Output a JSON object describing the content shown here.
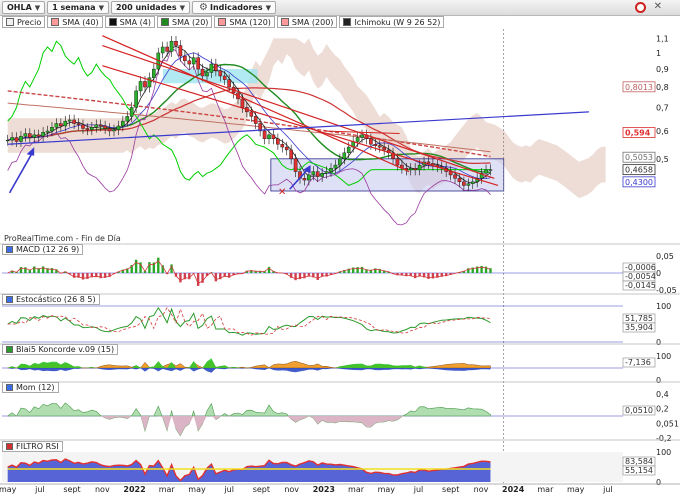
{
  "toolbar": {
    "symbol": "OHLA",
    "timeframe": "1 semana",
    "units": "200 unidades",
    "indicators": "Indicadores"
  },
  "legend": [
    {
      "label": "Precio",
      "color": "#f0f0f0"
    },
    {
      "label": "SMA (40)",
      "color": "#ff9999"
    },
    {
      "label": "SMA (4)",
      "color": "#101010"
    },
    {
      "label": "SMA (20)",
      "color": "#1f8b1f"
    },
    {
      "label": "SMA (120)",
      "color": "#ff9999"
    },
    {
      "label": "SMA (200)",
      "color": "#ff9999"
    },
    {
      "label": "Ichimoku (W 9 26 52)",
      "color": "#222222"
    }
  ],
  "source_label": "ProRealTime.com - Fin de Día",
  "panels": {
    "macd": {
      "title": "MACD (12 26 9)",
      "color": "#3a6ee8"
    },
    "stoch": {
      "title": "Estocástico (26 8 5)",
      "color": "#3a6ee8"
    },
    "koncorde": {
      "title": "Blai5 Koncorde v.09 (15)",
      "color": "#2a9a2a"
    },
    "mom": {
      "title": "Mom (12)",
      "color": "#3a6ee8"
    },
    "rsi": {
      "title": "FILTRO RSI",
      "color": "#d03030"
    }
  },
  "colors": {
    "bull_candle": "#2ab02a",
    "bear_candle": "#e03030",
    "trendline_red": "#d42222",
    "trendline_blue": "#3a3acf",
    "kumo_fill": "#e8d2c8",
    "support_box": "#c8ccee",
    "sma20": "#1f8b1f",
    "sma40": "#cc3333",
    "sma4": "#222222",
    "kijun": "#3a3acf",
    "senkou_b": "#c07060",
    "sma120": "#cc4444",
    "chikou": "#00d000"
  },
  "chart_data": [
    {
      "id": "price",
      "type": "candlestick",
      "x_label_positions": [
        "may",
        "jul",
        "sept",
        "nov",
        "2022",
        "mar",
        "may",
        "jul",
        "sept",
        "nov",
        "2023",
        "mar",
        "may",
        "jul",
        "sept",
        "nov",
        "2024",
        "mar",
        "may",
        "jul"
      ],
      "x_range": [
        2021.3,
        2024.58
      ],
      "y_scale": "log",
      "y_ticks": [
        1.1,
        1,
        0.9,
        0.8,
        0.7,
        0.6,
        0.5
      ],
      "y_range": [
        0.29,
        1.17
      ],
      "series": [
        {
          "name": "Precio",
          "weekly_close": [
            0.565,
            0.575,
            0.56,
            0.58,
            0.59,
            0.575,
            0.585,
            0.58,
            0.595,
            0.6,
            0.615,
            0.63,
            0.62,
            0.64,
            0.645,
            0.63,
            0.625,
            0.61,
            0.605,
            0.615,
            0.625,
            0.62,
            0.61,
            0.6,
            0.605,
            0.62,
            0.64,
            0.66,
            0.7,
            0.78,
            0.83,
            0.8,
            0.85,
            0.9,
            1.0,
            1.04,
            1.01,
            1.08,
            1.05,
            0.98,
            0.95,
            0.93,
            0.97,
            0.9,
            0.86,
            0.88,
            0.93,
            0.89,
            0.86,
            0.84,
            0.8,
            0.77,
            0.74,
            0.7,
            0.68,
            0.66,
            0.63,
            0.6,
            0.57,
            0.585,
            0.57,
            0.55,
            0.54,
            0.53,
            0.5,
            0.46,
            0.44,
            0.435,
            0.45,
            0.46,
            0.445,
            0.455,
            0.46,
            0.47,
            0.48,
            0.5,
            0.52,
            0.54,
            0.56,
            0.575,
            0.585,
            0.57,
            0.55,
            0.545,
            0.54,
            0.53,
            0.52,
            0.5,
            0.48,
            0.47,
            0.465,
            0.47,
            0.465,
            0.48,
            0.49,
            0.485,
            0.48,
            0.475,
            0.47,
            0.46,
            0.45,
            0.44,
            0.43,
            0.42,
            0.425,
            0.43,
            0.44,
            0.455,
            0.465,
            0.4658
          ]
        },
        {
          "name": "SMA (20)",
          "path": "smooth",
          "note": "green long-average line"
        },
        {
          "name": "SMA (40)",
          "path": "smooth",
          "note": "red long-average line"
        },
        {
          "name": "SMA (120)",
          "path": "smooth",
          "note": "dashed red/brown line"
        },
        {
          "name": "Ichimoku (W 9 26 52)",
          "path": "cloud",
          "note": "kumo cloud plus tenkan/kijun lines"
        }
      ],
      "annotations": [
        {
          "text": "0,8013",
          "color": "#c06060"
        },
        {
          "text": "0,594",
          "color": "#e03030",
          "emphasis": true
        },
        {
          "text": "0,5053",
          "color": "#707070"
        },
        {
          "text": "0,4658",
          "color": "#303030"
        },
        {
          "text": "0,4300",
          "color": "#3a3acf"
        }
      ]
    },
    {
      "id": "macd",
      "type": "histogram+lines",
      "title": "MACD (12 26 9)",
      "y_ticks": [
        0.05,
        0,
        -0.05
      ],
      "badges": [
        "-0,0006",
        "-0,0054",
        "-0,0145"
      ]
    },
    {
      "id": "stoch",
      "type": "line",
      "title": "Estocástico (26 8 5)",
      "y_ticks": [
        100,
        0
      ],
      "badges": [
        "51,785",
        "35,904"
      ]
    },
    {
      "id": "koncorde",
      "type": "area",
      "title": "Blai5 Koncorde v.09 (15)",
      "y_ticks": [
        100,
        0
      ],
      "badges": [
        "-7,136"
      ]
    },
    {
      "id": "mom",
      "type": "area",
      "title": "Mom (12)",
      "y_ticks": [
        0.4,
        0.2,
        0.051,
        -0.2
      ],
      "badges": [
        "0,0510"
      ]
    },
    {
      "id": "rsi",
      "type": "area",
      "title": "FILTRO RSI",
      "y_ticks": [
        100,
        0
      ],
      "badges": [
        "83,584",
        "55,154"
      ]
    }
  ]
}
